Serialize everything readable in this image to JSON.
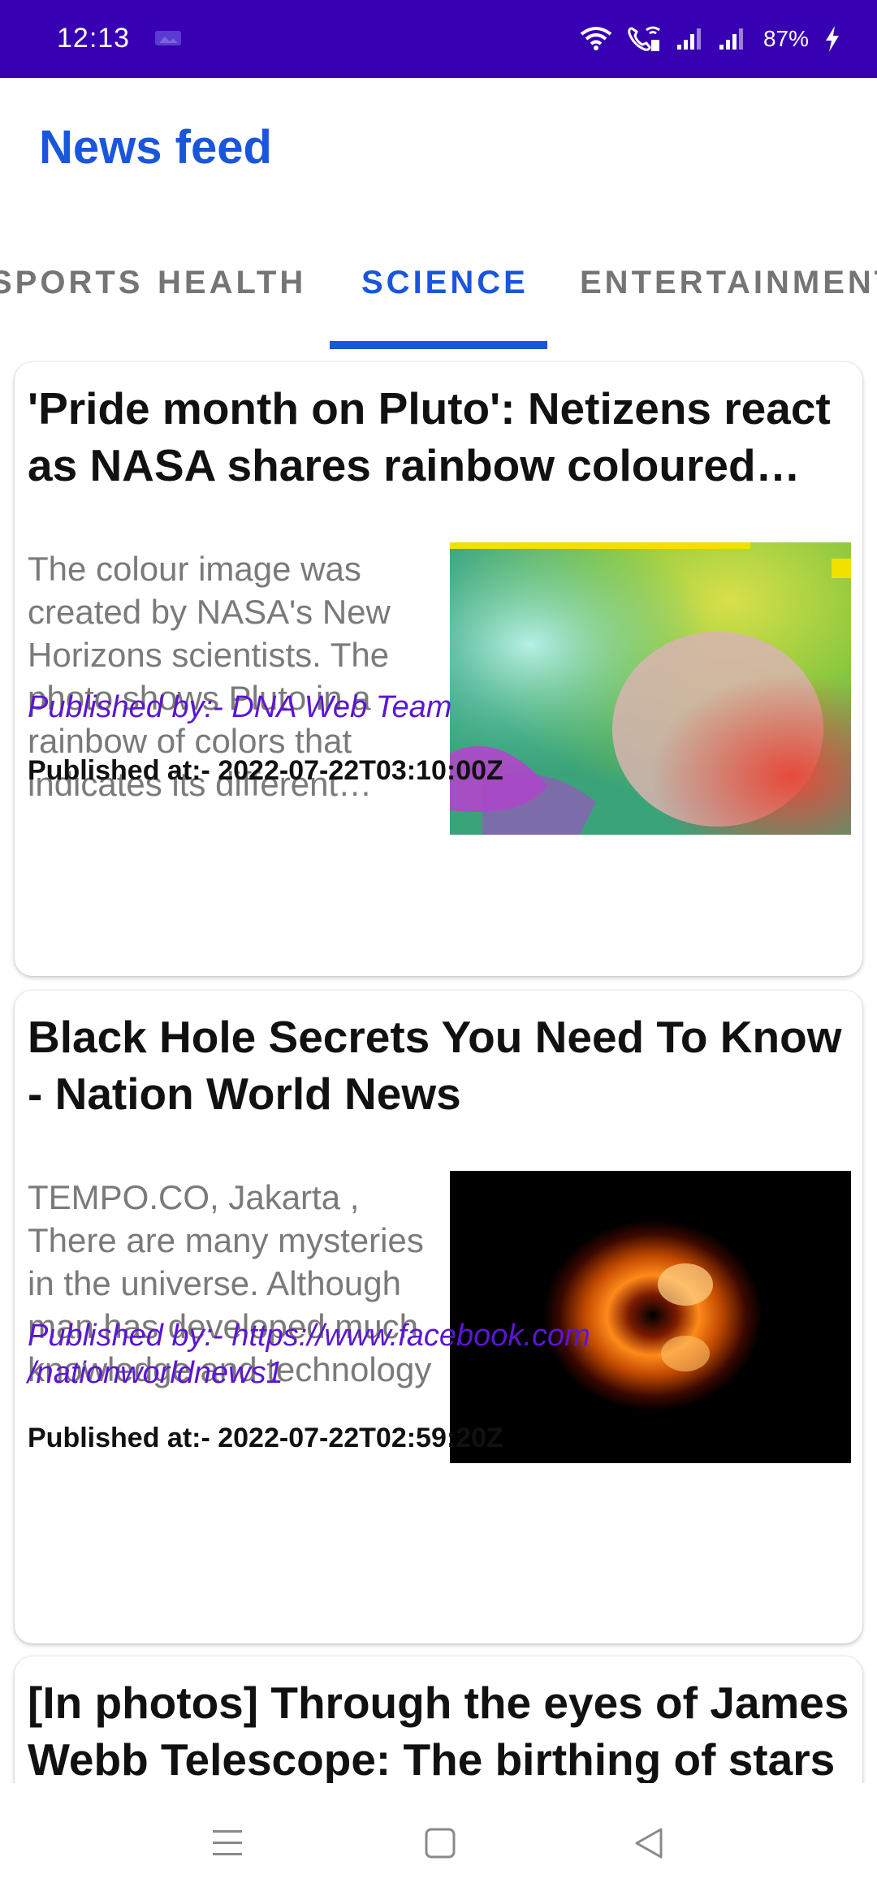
{
  "status_bar": {
    "time": "12:13",
    "battery": "87%",
    "icons": [
      "photo-icon",
      "wifi-icon",
      "vowifi-call-icon",
      "signal-1-icon",
      "signal-2-icon",
      "charging-bolt-icon"
    ]
  },
  "header": {
    "title": "News feed"
  },
  "tabs": [
    {
      "label": "SPORTS",
      "active": false
    },
    {
      "label": "HEALTH",
      "active": false
    },
    {
      "label": "SCIENCE",
      "active": true
    },
    {
      "label": "ENTERTAINMENT",
      "active": false
    }
  ],
  "articles": [
    {
      "title": "'Pride month on Pluto': Netizens react as NASA shares rainbow coloured photo of Pluto",
      "description": "The colour image was created by NASA's New Horizons scientists. The photo shows Pluto in a rainbow of colors that indicates its different regions",
      "author": "Published by:- DNA Web Team",
      "date": "Published at:- 2022-07-22T03:10:00Z",
      "image": "pluto-rainbow-photo"
    },
    {
      "title": "Black Hole Secrets You Need To Know - Nation World News",
      "description": "TEMPO.CO, Jakarta , There are many mysteries in the universe. Although man has developed much knowledge and technology",
      "author": "Published by:- https://www.facebook.com /nationworldnews1",
      "date": "Published at:- 2022-07-22T02:59:20Z",
      "image": "black-hole-photo"
    },
    {
      "title": "[In photos] Through the eyes of James Webb Telescope: The birthing of stars"
    }
  ],
  "colors": {
    "status_bar": "#3700b3",
    "accent": "#1a56db",
    "author_text": "#5b16d1",
    "description_text": "#7a7a7a"
  },
  "nav_bar": {
    "icons": [
      "menu-icon",
      "home-square-icon",
      "back-triangle-icon"
    ]
  }
}
